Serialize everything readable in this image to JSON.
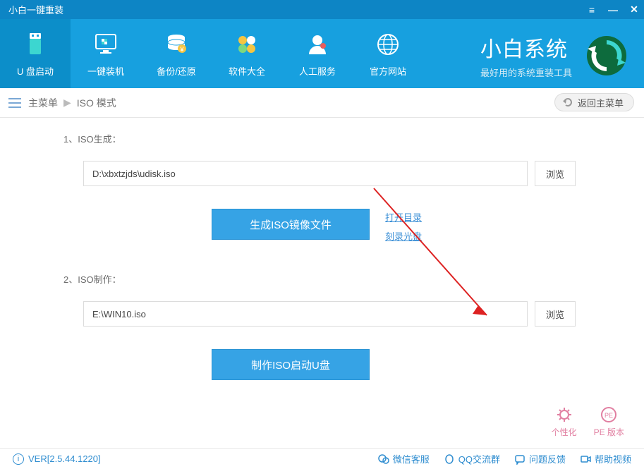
{
  "titlebar": {
    "title": "小白一键重装"
  },
  "nav": {
    "items": [
      {
        "label": "U 盘启动"
      },
      {
        "label": "一键装机"
      },
      {
        "label": "备份/还原"
      },
      {
        "label": "软件大全"
      },
      {
        "label": "人工服务"
      },
      {
        "label": "官方网站"
      }
    ]
  },
  "brand": {
    "line1": "小白系统",
    "line2": "最好用的系统重装工具"
  },
  "breadcrumb": {
    "main": "主菜单",
    "current": "ISO 模式",
    "back": "返回主菜单"
  },
  "section1": {
    "label": "1、ISO生成：",
    "path": "D:\\xbxtzjds\\udisk.iso",
    "browse": "浏览",
    "button": "生成ISO镜像文件",
    "link1": "打开目录",
    "link2": "刻录光盘"
  },
  "section2": {
    "label": "2、ISO制作：",
    "path": "E:\\WIN10.iso",
    "browse": "浏览",
    "button": "制作ISO启动U盘"
  },
  "bottom": {
    "personalize": "个性化",
    "pe": "PE 版本"
  },
  "statusbar": {
    "version": "VER[2.5.44.1220]",
    "wechat": "微信客服",
    "qq": "QQ交流群",
    "feedback": "问题反馈",
    "help": "帮助视频"
  }
}
